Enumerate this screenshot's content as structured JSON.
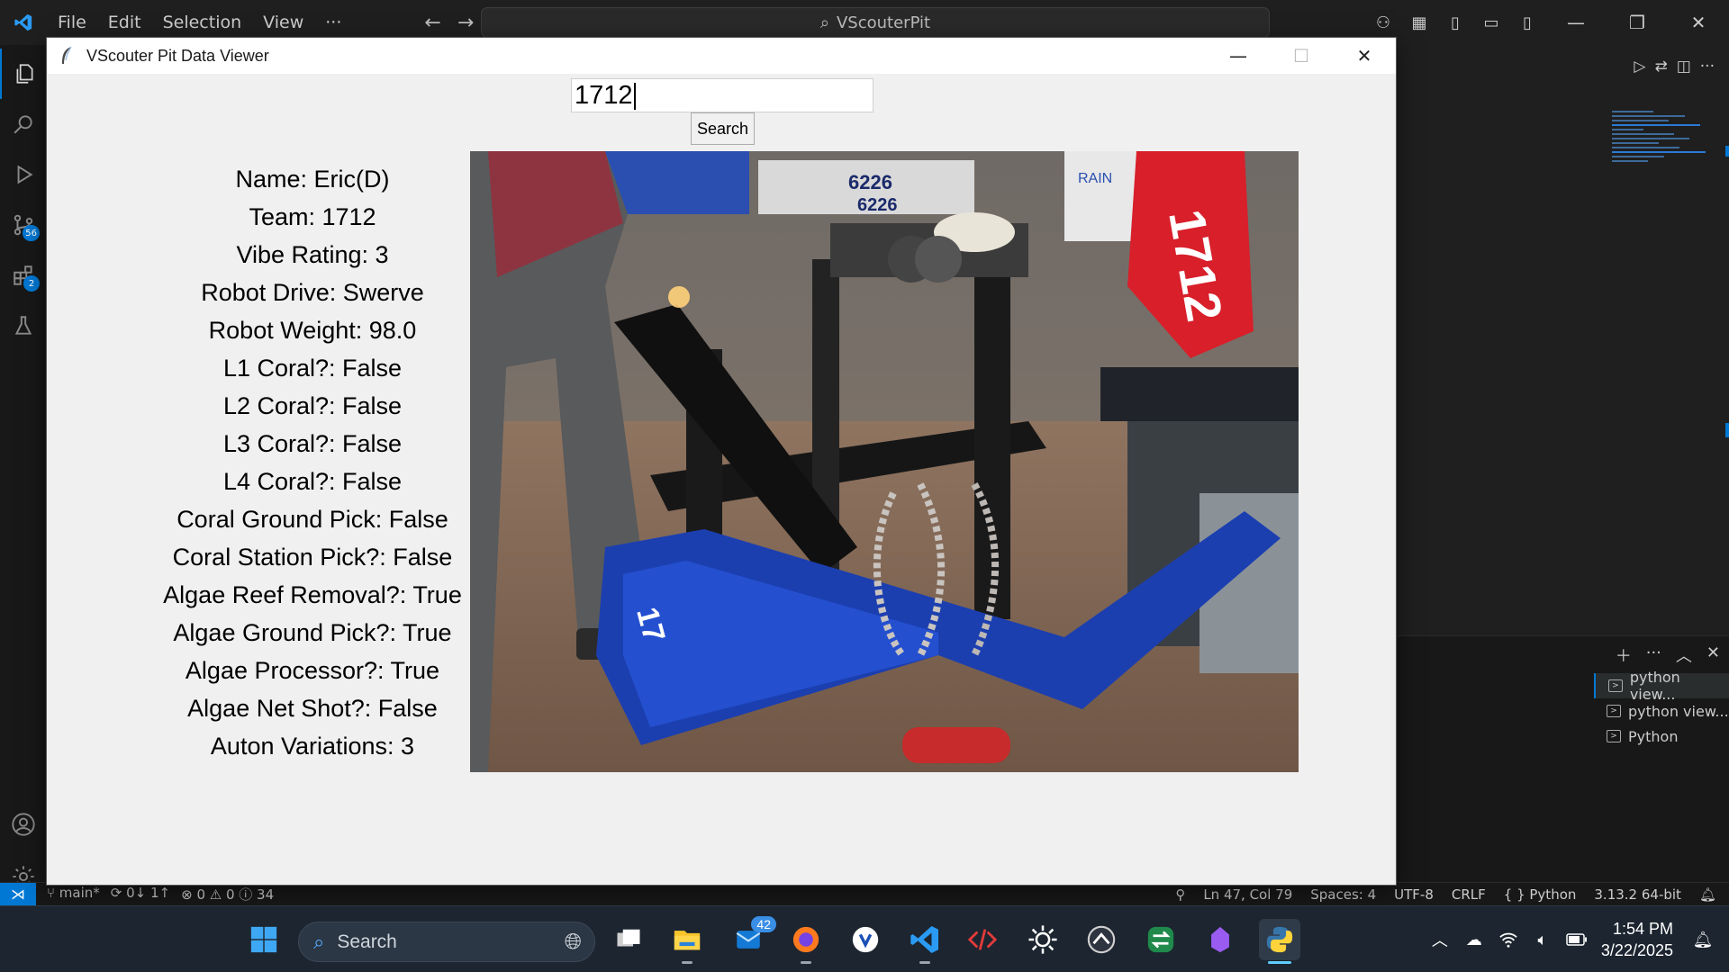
{
  "vscode": {
    "menu": [
      "File",
      "Edit",
      "Selection",
      "View",
      "···"
    ],
    "command_center": "VScouterPit",
    "status": {
      "branch": "main*",
      "sync": "0↓ 1↑",
      "problems": "⊗ 0 ⚠ 0 ⓘ 34",
      "cursor": "Ln 47, Col 79",
      "spaces": "Spaces: 4",
      "encoding": "UTF-8",
      "eol": "CRLF",
      "language": "{ } Python",
      "interpreter": "3.13.2 64-bit"
    },
    "activity_badges": {
      "source_control": "56",
      "extensions": "2"
    },
    "terminals": [
      "python view...",
      "python view...",
      "Python"
    ]
  },
  "app": {
    "title": "VScouter Pit Data Viewer",
    "search_value": "1712",
    "search_button": "Search",
    "fields": [
      "Name: Eric(D)",
      "Team: 1712",
      "Vibe Rating: 3",
      "Robot Drive: Swerve",
      "Robot Weight: 98.0",
      "L1 Coral?: False",
      "L2 Coral?: False",
      "L3 Coral?: False",
      "L4 Coral?: False",
      "Coral Ground Pick: False",
      "Coral Station Pick?: False",
      "Algae Reef Removal?: True",
      "Algae Ground Pick?: True",
      "Algae Processor?: True",
      "Algae Net Shot?: False",
      "Auton Variations: 3"
    ],
    "photo_texts": [
      "6226",
      "6226",
      "1712",
      "RAIN"
    ]
  },
  "taskbar": {
    "search_label": "Search",
    "mail_badge": "42",
    "time": "1:54 PM",
    "date": "3/22/2025"
  },
  "colors": {
    "accent": "#0078d4",
    "robot_bumper": "#1c3fb0",
    "banner": "#d81f2a"
  }
}
